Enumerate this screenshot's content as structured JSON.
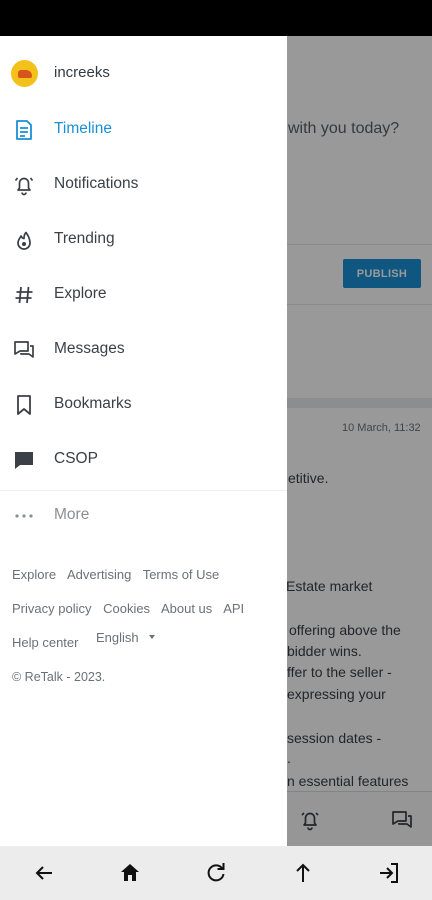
{
  "drawer": {
    "username": "increeks",
    "nav_items": [
      {
        "label": "Timeline",
        "icon": "document-icon",
        "active": true
      },
      {
        "label": "Notifications",
        "icon": "bell-icon"
      },
      {
        "label": "Trending",
        "icon": "flame-icon"
      },
      {
        "label": "Explore",
        "icon": "hashtag-icon"
      },
      {
        "label": "Messages",
        "icon": "chat-bubbles-icon"
      },
      {
        "label": "Bookmarks",
        "icon": "bookmark-icon"
      },
      {
        "label": "CSOP",
        "icon": "chat-square-icon"
      },
      {
        "label": "More",
        "icon": "ellipsis-icon"
      }
    ],
    "footer_links": [
      "Explore",
      "Advertising",
      "Terms of Use",
      "Privacy policy",
      "Cookies",
      "About us",
      "API",
      "Help center"
    ],
    "language": "English",
    "copyright": "© ReTalk - 2023."
  },
  "background": {
    "prompt_fragment": "with you today?",
    "publish_label": "PUBLISH",
    "post_date": "10 March, 11:32",
    "text_fragments": [
      "etitive.",
      "Estate market",
      "offering above the",
      "bidder wins.",
      "ffer to the seller -",
      "expressing your",
      "session dates -",
      ".",
      "n essential features"
    ]
  },
  "colors": {
    "accent": "#1a8fd6",
    "scrim": "rgba(0,0,0,0.40)"
  }
}
